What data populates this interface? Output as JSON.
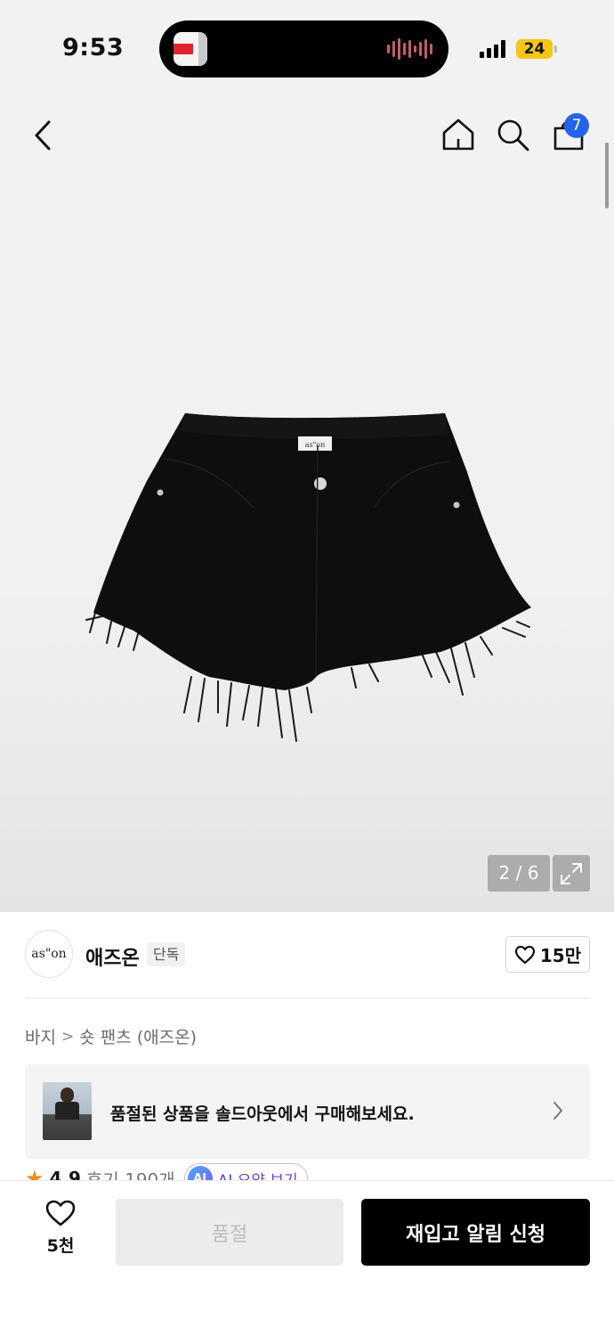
{
  "status_bar": {
    "time": "9:53",
    "battery": "24",
    "battery_color": "#f5c518"
  },
  "header": {
    "back_icon": "chevron-left-icon",
    "home_icon": "home-icon",
    "search_icon": "search-icon",
    "cart_icon": "shopping-bag-icon",
    "cart_badge": "7",
    "badge_color": "#2563eb"
  },
  "gallery": {
    "page_counter": "2 / 6",
    "current_page": 2,
    "total_pages": 6,
    "expand_icon": "expand-icon",
    "label_text": "as\"on"
  },
  "brand": {
    "logo_text": "as\"on",
    "name": "애즈온",
    "tag": "단독",
    "like_count": "15만",
    "like_icon": "heart-outline-icon"
  },
  "breadcrumb": {
    "category": "바지",
    "sub_category": "숏 팬츠 (애즈온)"
  },
  "banner": {
    "text": "품절된 상품을 솔드아웃에서 구매해보세요.",
    "chevron_icon": "chevron-right-icon"
  },
  "rating": {
    "score": "4.9",
    "reviews": "후기 190개",
    "ai_badge": "AI",
    "ai_summary": "AI 요약 보기",
    "star_color": "#f08c1a"
  },
  "bottom_bar": {
    "wish_count": "5천",
    "soldout_label": "품절",
    "restock_label": "재입고 알림 신청"
  }
}
